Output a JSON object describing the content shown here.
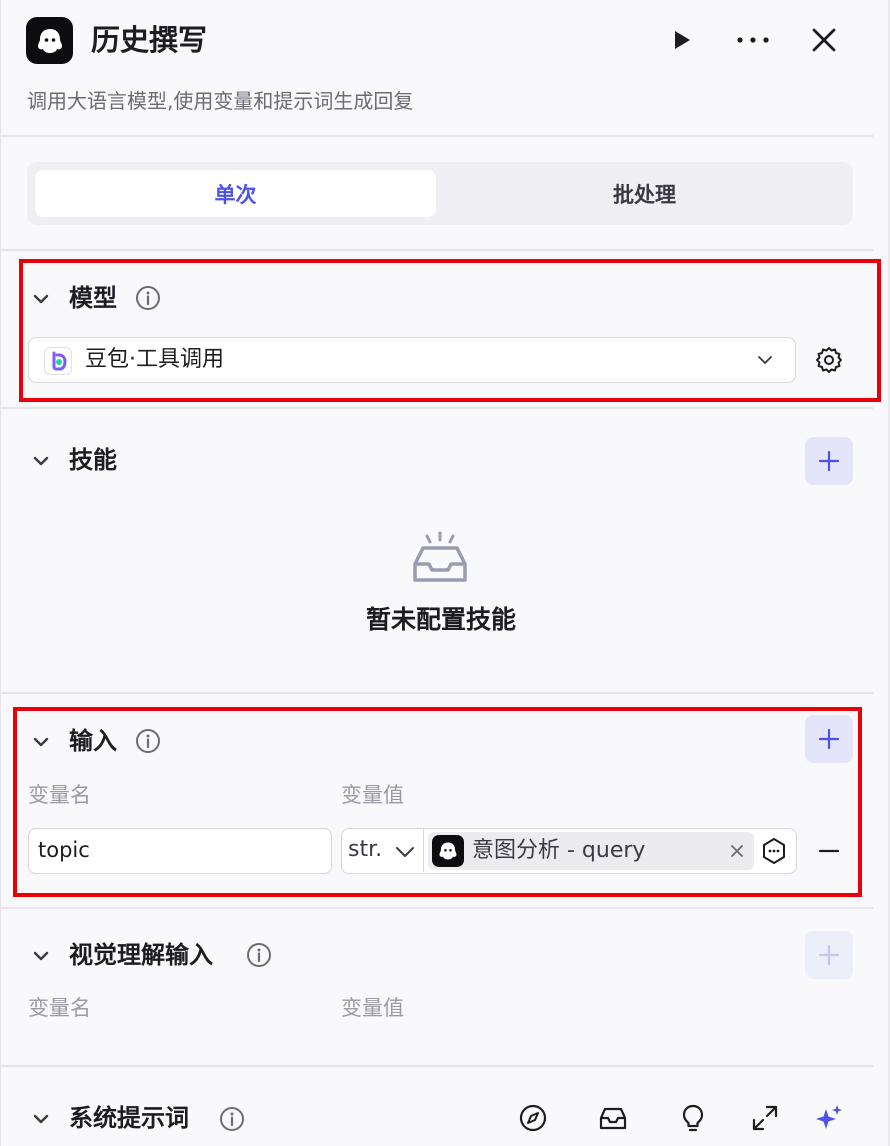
{
  "header": {
    "title": "历史撰写",
    "description": "调用大语言模型,使用变量和提示词生成回复",
    "node_icon": "ghost-logo-icon",
    "actions": [
      "play-icon",
      "more-icon",
      "close-icon"
    ]
  },
  "tabs": [
    {
      "label": "单次",
      "active": true
    },
    {
      "label": "批处理",
      "active": false
    }
  ],
  "model": {
    "title": "模型",
    "selected": "豆包·工具调用"
  },
  "skills": {
    "title": "技能",
    "empty_text": "暂未配置技能"
  },
  "input": {
    "title": "输入",
    "col_name": "变量名",
    "col_value": "变量值",
    "rows": [
      {
        "name": "topic",
        "type": "str.",
        "ref": "意图分析 - query"
      }
    ]
  },
  "vision_input": {
    "title": "视觉理解输入",
    "col_name": "变量名",
    "col_value": "变量值"
  },
  "system_prompt": {
    "title": "系统提示词"
  },
  "colors": {
    "accent": "#4d53e8",
    "highlight_border": "#e8000b"
  }
}
